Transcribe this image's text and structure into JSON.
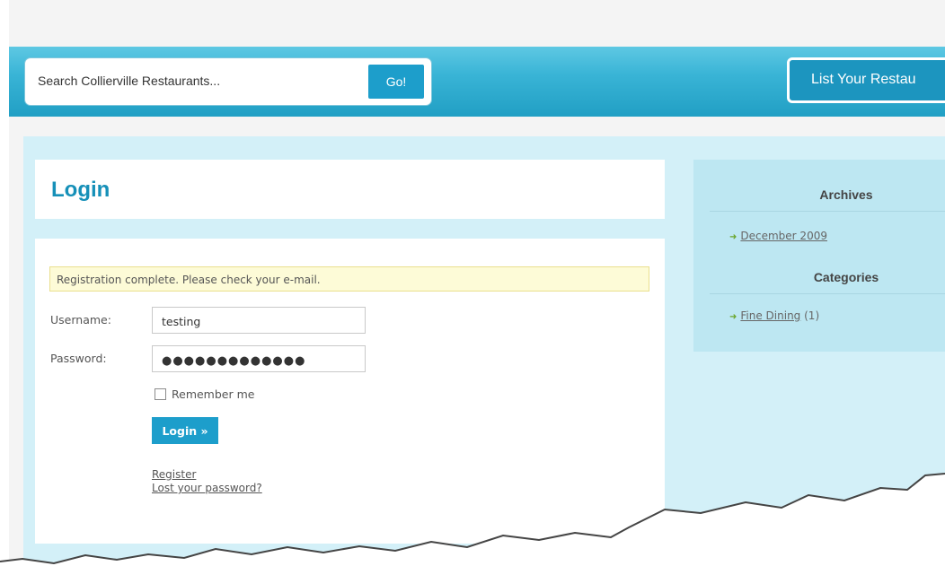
{
  "header": {
    "search_placeholder": "Search Collierville Restaurants...",
    "go_label": "Go!",
    "list_button_label": "List Your Restau"
  },
  "login": {
    "title": "Login",
    "notice": "Registration complete. Please check your e-mail.",
    "username_label": "Username:",
    "username_value": "testing",
    "password_label": "Password:",
    "password_value": "●●●●●●●●●●●●●",
    "remember_label": "Remember me",
    "login_button": "Login »",
    "register_link": "Register",
    "lost_password_link": "Lost your password?"
  },
  "sidebar": {
    "archives_heading": "Archives",
    "archives_item": "December 2009",
    "categories_heading": "Categories",
    "category_item": "Fine Dining",
    "category_count": "(1)"
  },
  "colors": {
    "header_blue": "#2aa8cf",
    "button_blue": "#1d9ecb",
    "title_blue": "#1690b8",
    "content_bg": "#d3f0f8",
    "sidebar_bg": "#bde7f2",
    "notice_bg": "#fdfbd7"
  },
  "icons": {
    "list_arrow": "green-arrow-icon"
  }
}
